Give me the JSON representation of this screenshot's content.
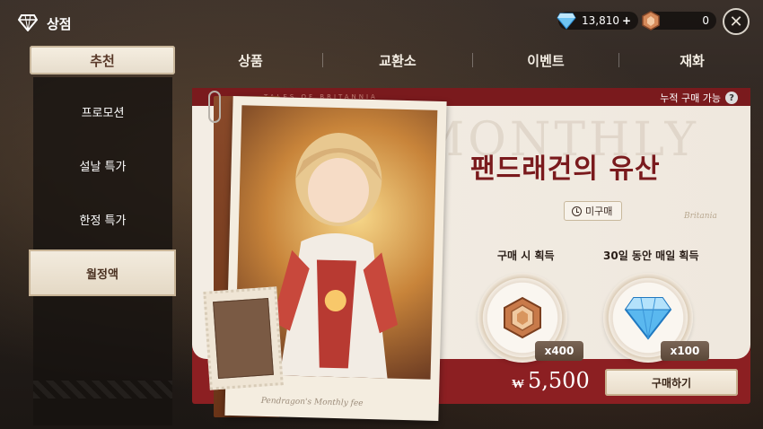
{
  "header": {
    "title": "상점",
    "shop_icon": "diamond-shop-icon",
    "gem_amount": "13,810",
    "gem_plus": "+",
    "coin_amount": "0",
    "close_icon": "close-icon"
  },
  "tabs": [
    {
      "label": "추천",
      "active": true
    },
    {
      "label": "상품",
      "active": false
    },
    {
      "label": "교환소",
      "active": false
    },
    {
      "label": "이벤트",
      "active": false
    },
    {
      "label": "재화",
      "active": false
    }
  ],
  "sidebar": {
    "items": [
      {
        "label": "프로모션",
        "active": false
      },
      {
        "label": "설날 특가",
        "active": false
      },
      {
        "label": "한정 특가",
        "active": false
      },
      {
        "label": "월정액",
        "active": true
      }
    ]
  },
  "card": {
    "top_strip_text": "TALES OF BRITANNIA",
    "accumulated_label": "누적 구매 가능",
    "help_icon": "?",
    "watermark": "MONTHLY",
    "title": "팬드래건의 유산",
    "status": "미구매",
    "brand": "Britania",
    "reward_on_purchase_label": "구매 시 획득",
    "reward_on_purchase_qty": "x400",
    "reward_daily_label": "30일 동안 매일 획득",
    "reward_daily_qty": "x100",
    "currency_symbol": "₩",
    "price": "5,500",
    "buy_label": "구매하기",
    "photo_caption": "Pendragon's Monthly fee"
  },
  "colors": {
    "accent_red": "#8c1f22",
    "title_red": "#7a1a1d",
    "cream": "#f3ede4"
  }
}
